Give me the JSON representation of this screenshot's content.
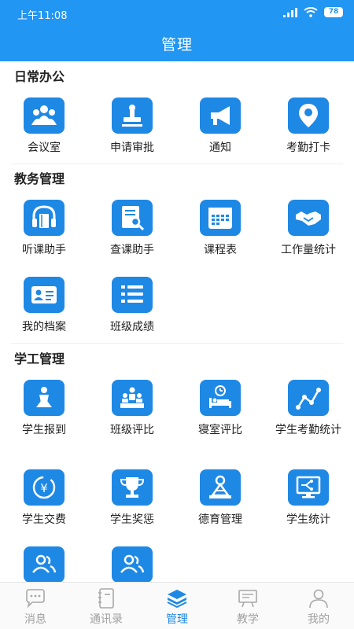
{
  "status": {
    "time": "上午11:08",
    "battery": "78"
  },
  "header": {
    "title": "管理"
  },
  "sections": [
    {
      "title": "日常办公",
      "items": [
        {
          "label": "会议室",
          "icon": "meeting-room-icon"
        },
        {
          "label": "申请审批",
          "icon": "stamp-icon"
        },
        {
          "label": "通知",
          "icon": "megaphone-icon"
        },
        {
          "label": "考勤打卡",
          "icon": "location-pin-icon"
        }
      ]
    },
    {
      "title": "教务管理",
      "items": [
        {
          "label": "听课助手",
          "icon": "headphones-book-icon"
        },
        {
          "label": "查课助手",
          "icon": "search-document-icon"
        },
        {
          "label": "课程表",
          "icon": "calendar-icon"
        },
        {
          "label": "工作量统计",
          "icon": "handshake-icon"
        },
        {
          "label": "我的档案",
          "icon": "id-card-icon"
        },
        {
          "label": "班级成绩",
          "icon": "numbered-list-icon"
        }
      ]
    },
    {
      "title": "学工管理",
      "items": [
        {
          "label": "学生报到",
          "icon": "student-report-icon"
        },
        {
          "label": "班级评比",
          "icon": "class-ranking-icon"
        },
        {
          "label": "寝室评比",
          "icon": "dorm-bed-icon"
        },
        {
          "label": "学生考勤统计",
          "icon": "line-chart-icon"
        },
        {
          "label": "学生交费",
          "icon": "yuan-coin-icon"
        },
        {
          "label": "学生奖惩",
          "icon": "trophy-icon"
        },
        {
          "label": "德育管理",
          "icon": "moral-education-icon"
        },
        {
          "label": "学生统计",
          "icon": "monitor-chart-icon"
        },
        {
          "label": "",
          "icon": "users-icon"
        },
        {
          "label": "",
          "icon": "users-icon"
        }
      ]
    }
  ],
  "tabs": [
    {
      "label": "消息",
      "icon": "chat-bubble-icon",
      "active": false
    },
    {
      "label": "通讯录",
      "icon": "address-book-icon",
      "active": false
    },
    {
      "label": "管理",
      "icon": "layers-icon",
      "active": true
    },
    {
      "label": "教学",
      "icon": "blackboard-icon",
      "active": false
    },
    {
      "label": "我的",
      "icon": "person-icon",
      "active": false
    }
  ],
  "colors": {
    "primary": "#2196f3",
    "icon_bg": "#1e88e5",
    "tab_inactive": "#a0a0a0"
  }
}
